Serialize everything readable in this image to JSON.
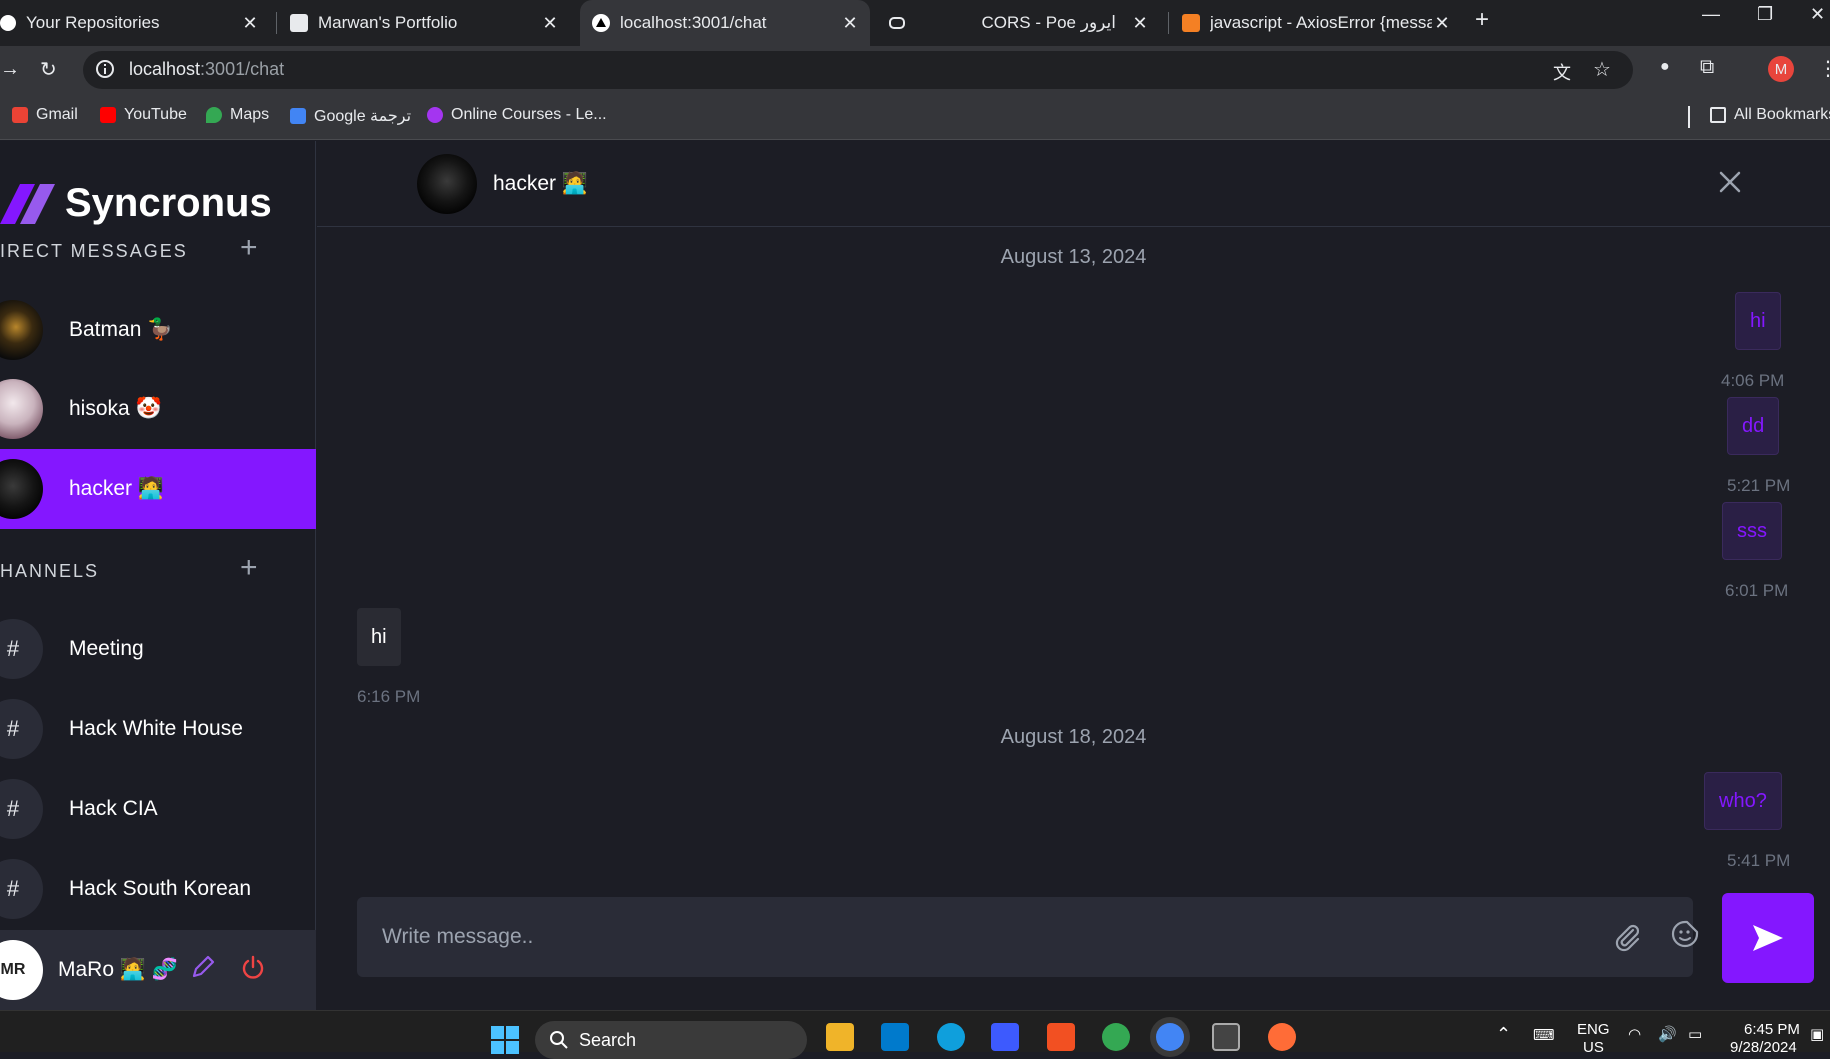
{
  "browser": {
    "tabs": [
      {
        "title": "Your Repositories",
        "close": "✕"
      },
      {
        "title": "Marwan's Portfolio",
        "close": "✕"
      },
      {
        "title": "localhost:3001/chat",
        "close": "✕"
      },
      {
        "title": "CORS - Poe ایرور",
        "close": "✕"
      },
      {
        "title": "javascript - AxiosError {message",
        "close": "✕"
      }
    ],
    "new_tab": "+",
    "url_host": "localhost",
    "url_path": ":3001/chat",
    "profile_initial": "M",
    "bookmarks": [
      "Gmail",
      "YouTube",
      "Maps",
      "Google ترجمة",
      "Online Courses - Le..."
    ],
    "all_bookmarks": "All Bookmarks"
  },
  "sidebar": {
    "app_name": "Syncronus",
    "dm_title": "IRECT MESSAGES",
    "channels_title": "HANNELS",
    "contacts": [
      {
        "name": "Batman 🦆"
      },
      {
        "name": "hisoka 🤡"
      },
      {
        "name": "hacker 🧑‍💻"
      }
    ],
    "channels": [
      {
        "hash": "#",
        "name": "Meeting"
      },
      {
        "hash": "#",
        "name": "Hack White House"
      },
      {
        "hash": "#",
        "name": "Hack CIA"
      },
      {
        "hash": "#",
        "name": "Hack South Korean"
      }
    ],
    "profile": {
      "initials": "MR",
      "name": "MaRo 🧑‍💻 🧬"
    }
  },
  "chat": {
    "contact_name": "hacker 🧑‍💻",
    "dates": [
      "August 13, 2024",
      "August 18, 2024"
    ],
    "messages": [
      {
        "text": "hi",
        "time": "4:06 PM"
      },
      {
        "text": "dd",
        "time": "5:21 PM"
      },
      {
        "text": "sss",
        "time": "6:01 PM"
      },
      {
        "text": "hi",
        "time": "6:16 PM"
      },
      {
        "text": "who?",
        "time": "5:41 PM"
      }
    ],
    "input_placeholder": "Write message.."
  },
  "taskbar": {
    "search_label": "Search",
    "lang_1": "ENG",
    "lang_2": "US",
    "time": "6:45 PM",
    "date": "9/28/2024"
  }
}
